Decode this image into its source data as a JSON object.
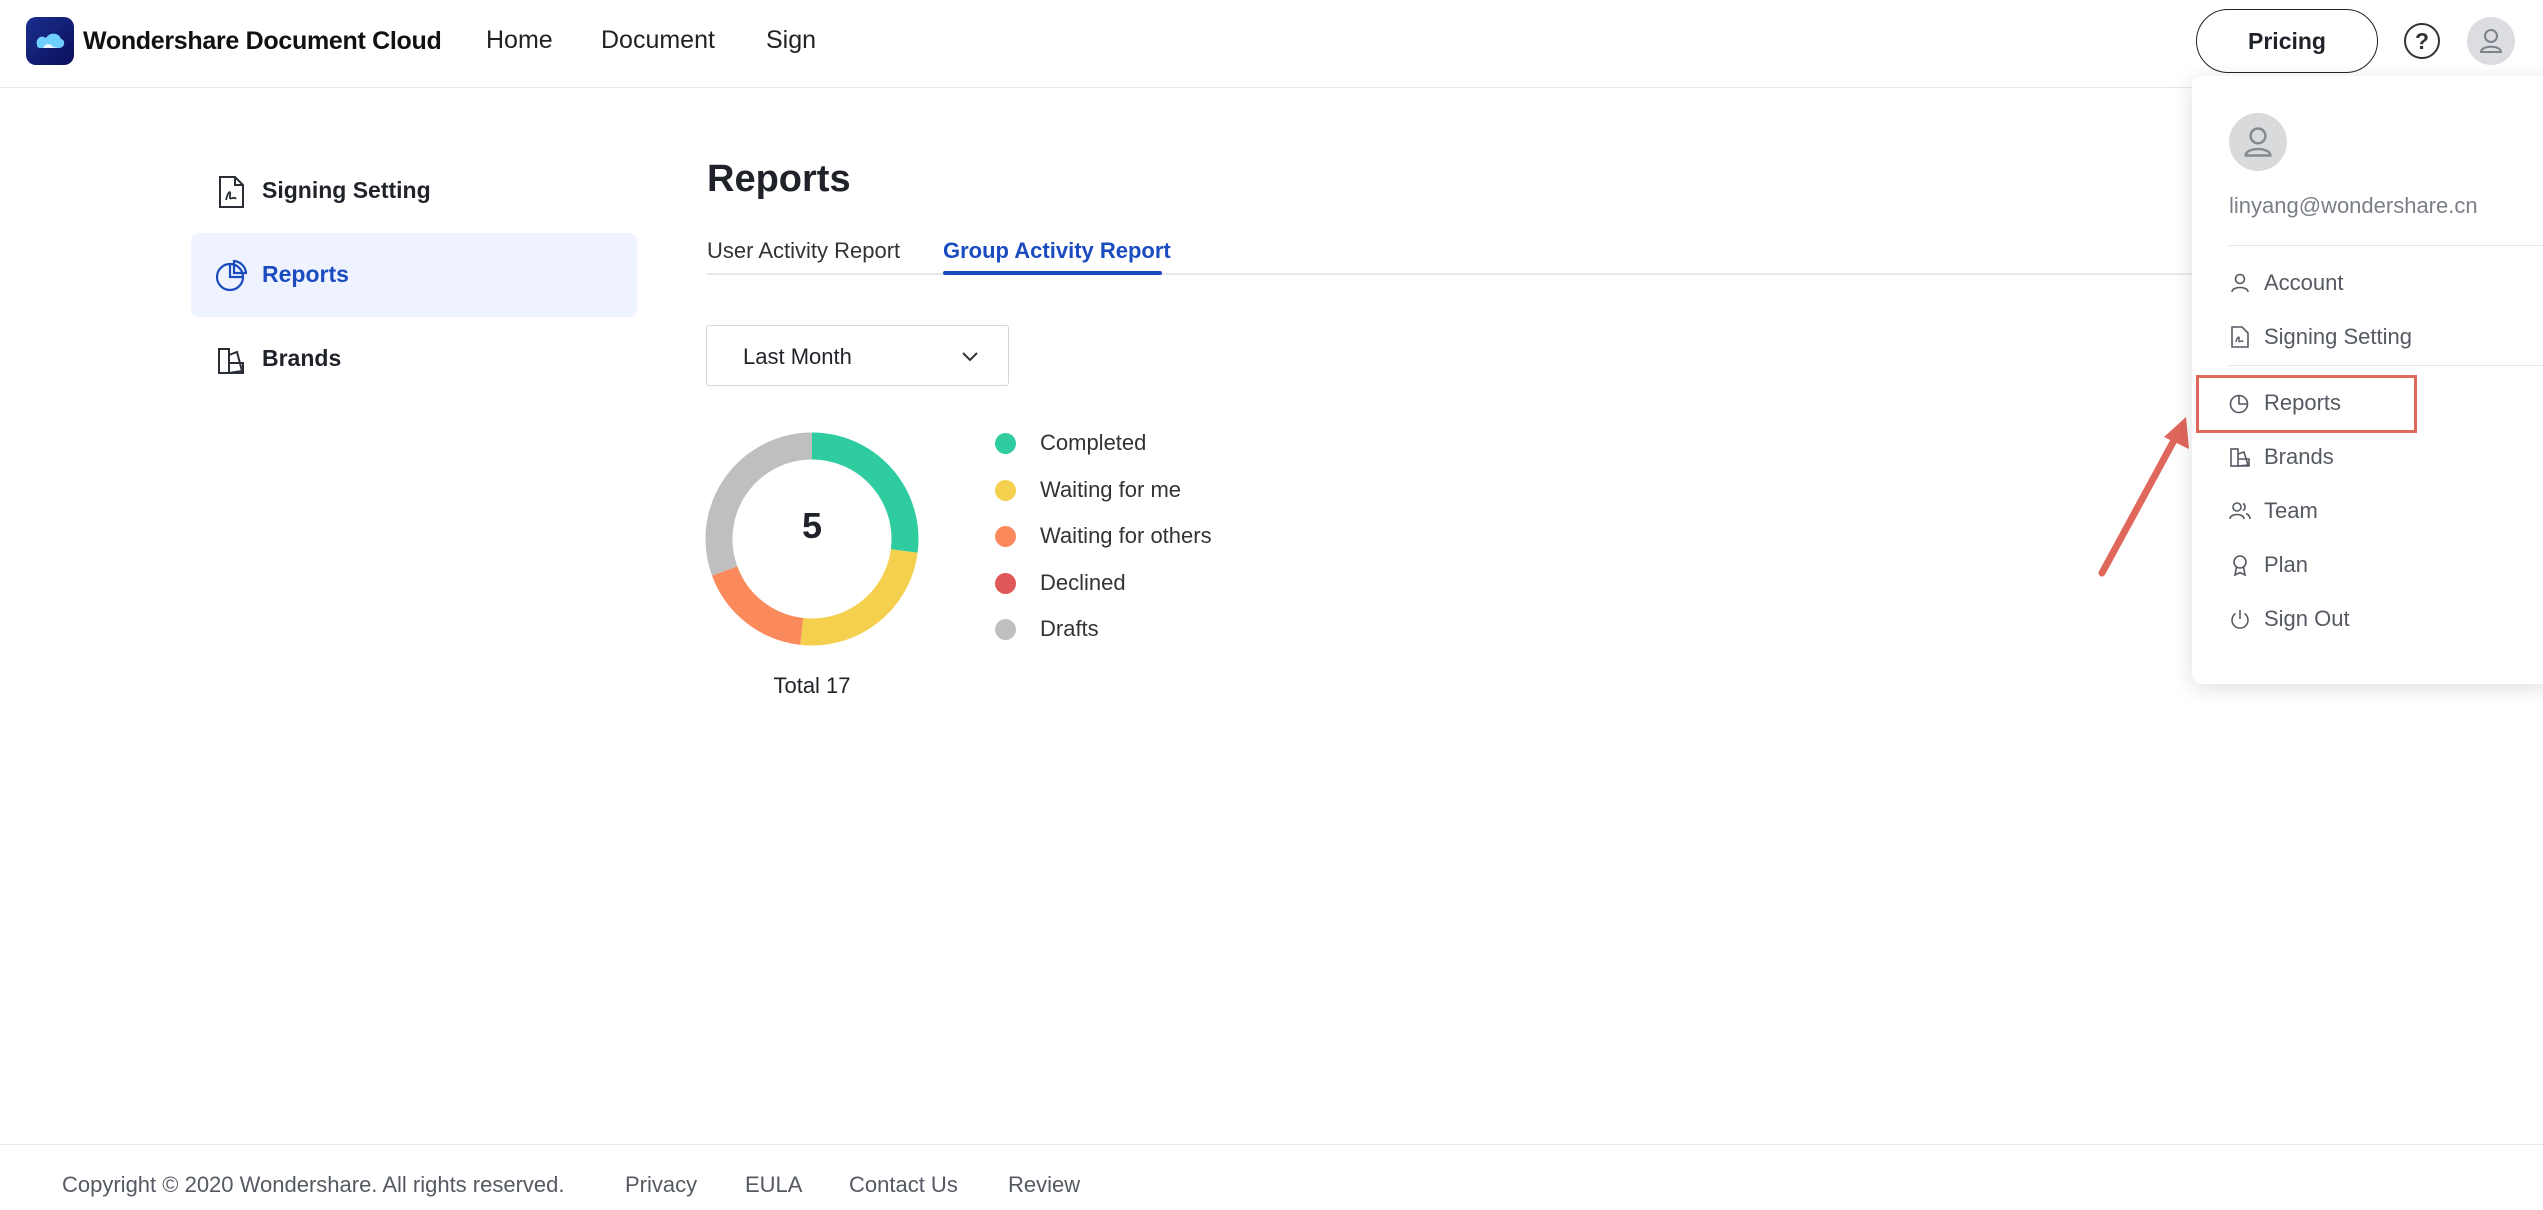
{
  "header": {
    "brand": "Wondershare Document Cloud",
    "nav": [
      "Home",
      "Document",
      "Sign"
    ],
    "pricing_label": "Pricing",
    "help_glyph": "?"
  },
  "sidebar": {
    "items": [
      {
        "label": "Signing Setting",
        "icon": "signing-document-icon"
      },
      {
        "label": "Reports",
        "icon": "pie-chart-icon",
        "active": true
      },
      {
        "label": "Brands",
        "icon": "brands-icon"
      }
    ]
  },
  "main": {
    "title": "Reports",
    "tabs": [
      {
        "label": "User Activity Report",
        "active": false
      },
      {
        "label": "Group Activity Report",
        "active": true
      }
    ],
    "period_select": {
      "value": "Last Month"
    },
    "chart_center_value": "5",
    "total_label": "Total 17"
  },
  "chart_data": {
    "type": "pie",
    "donut": true,
    "center_value": 5,
    "legend": [
      "Completed",
      "Waiting for me",
      "Waiting for others",
      "Declined",
      "Drafts"
    ],
    "slices": [
      {
        "name": "Completed",
        "value": 4.6,
        "color": "#2ecc9f"
      },
      {
        "name": "Waiting for me",
        "value": 4.2,
        "color": "#f5d04f"
      },
      {
        "name": "Waiting for others",
        "value": 3.0,
        "color": "#fa8a5c"
      },
      {
        "name": "Declined",
        "value": 0,
        "color": "#e05757"
      },
      {
        "name": "Drafts",
        "value": 5.2,
        "color": "#bfbfbf"
      }
    ]
  },
  "account_menu": {
    "email": "linyang@wondershare.cn",
    "items": [
      {
        "label": "Account",
        "icon": "user-icon"
      },
      {
        "label": "Signing Setting",
        "icon": "signing-document-icon"
      },
      {
        "label": "Reports",
        "icon": "pie-chart-icon"
      },
      {
        "label": "Brands",
        "icon": "brands-icon"
      },
      {
        "label": "Team",
        "icon": "team-icon"
      },
      {
        "label": "Plan",
        "icon": "award-icon"
      },
      {
        "label": "Sign Out",
        "icon": "power-icon"
      }
    ],
    "annotation_color": "#e0675c"
  },
  "footer": {
    "copyright": "Copyright © 2020 Wondershare. All rights reserved.",
    "links": [
      "Privacy",
      "EULA",
      "Contact Us",
      "Review"
    ]
  }
}
